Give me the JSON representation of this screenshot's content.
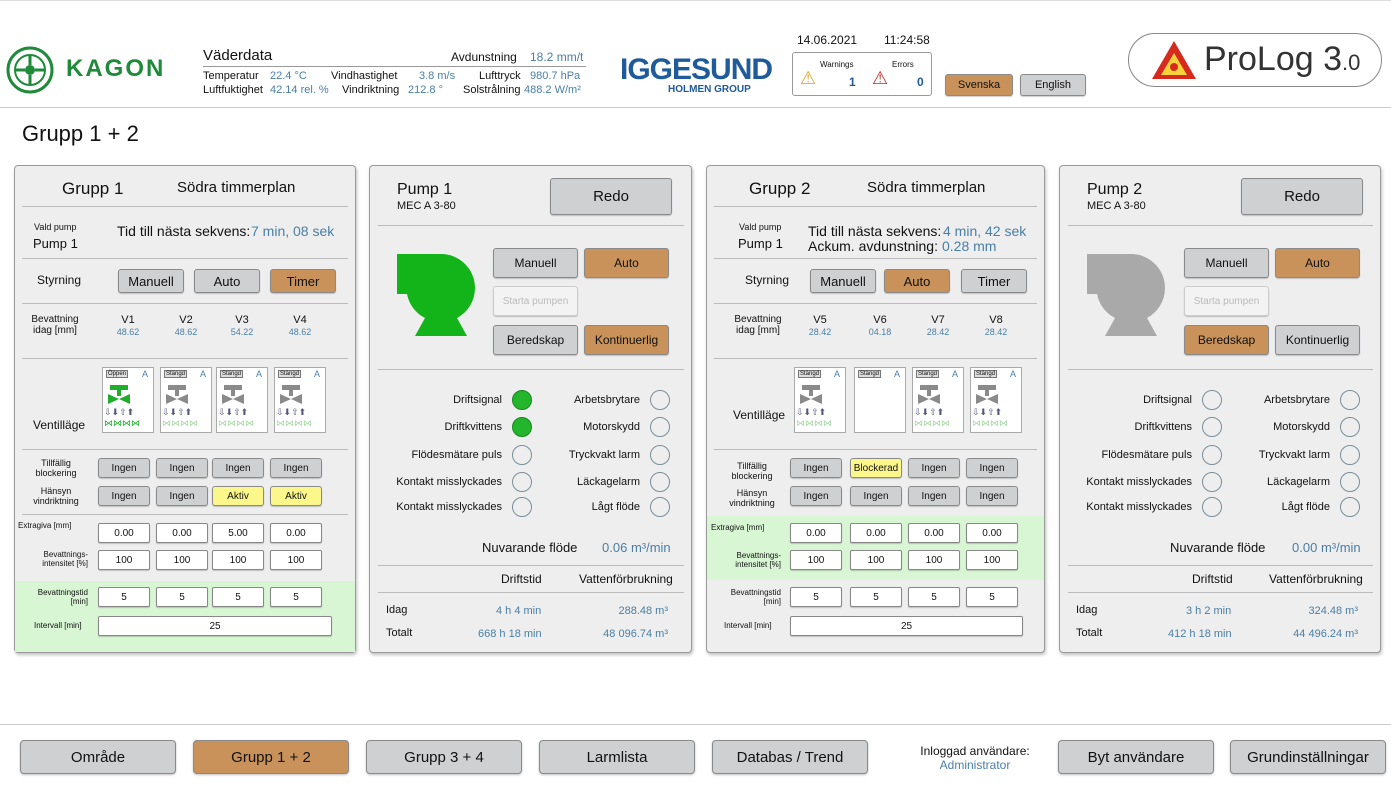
{
  "header": {
    "kagon": "KAGON",
    "kagon_small": "KAGON",
    "weather": {
      "title": "Väderdata",
      "temp_label": "Temperatur",
      "temp_value": "22.4",
      "temp_unit": "°C",
      "humid_label": "Luftfuktighet",
      "humid_value": "42.14",
      "humid_unit": "rel. %",
      "wind_label": "Vindhastighet",
      "wind_value": "3.8",
      "wind_unit": "m/s",
      "dir_label": "Vindriktning",
      "dir_value": "212.8",
      "dir_unit": "°",
      "evap_label": "Avdunstning",
      "evap_value": "18.2",
      "evap_unit": "mm/t",
      "press_label": "Lufttryck",
      "press_value": "980.7",
      "press_unit": "hPa",
      "sun_label": "Solstrålning",
      "sun_value": "488.2",
      "sun_unit": "W/m²"
    },
    "iggesund": "IGGESUND",
    "holmen": "HOLMEN GROUP",
    "date": "14.06.2021",
    "time": "11:24:58",
    "warnings_label": "Warnings",
    "warnings_count": "1",
    "errors_label": "Errors",
    "errors_count": "0",
    "lang_sv": "Svenska",
    "lang_en": "English",
    "prolog": "ProLog 3",
    "prolog_sub": ".0"
  },
  "page_title": "Grupp 1 + 2",
  "grupp1": {
    "title": "Grupp 1",
    "area": "Södra timmerplan",
    "vald_pump_label": "Vald pump",
    "vald_pump": "Pump 1",
    "tid_label": "Tid till nästa sekvens:",
    "tid_value": "7 min, 08 sek",
    "styrning": "Styrning",
    "manuell": "Manuell",
    "auto": "Auto",
    "timer": "Timer",
    "bev_label1": "Bevattning",
    "bev_label2": "idag [mm]",
    "valves": [
      {
        "name": "V1",
        "value": "48.62",
        "state": "Öppen",
        "mode": "A",
        "blocking": "Ingen",
        "wind": "Ingen",
        "extra": "0.00",
        "intens": "100",
        "tid": "5"
      },
      {
        "name": "V2",
        "value": "48.62",
        "state": "Stängd",
        "mode": "A",
        "blocking": "Ingen",
        "wind": "Ingen",
        "extra": "0.00",
        "intens": "100",
        "tid": "5"
      },
      {
        "name": "V3",
        "value": "54.22",
        "state": "Stängd",
        "mode": "A",
        "blocking": "Ingen",
        "wind": "Aktiv",
        "extra": "5.00",
        "intens": "100",
        "tid": "5"
      },
      {
        "name": "V4",
        "value": "48.62",
        "state": "Stängd",
        "mode": "A",
        "blocking": "Ingen",
        "wind": "Aktiv",
        "extra": "0.00",
        "intens": "100",
        "tid": "5"
      }
    ],
    "ventillage": "Ventilläge",
    "tillf1": "Tillfällig",
    "tillf2": "blockering",
    "hans1": "Hänsyn",
    "hans2": "vindriktning",
    "extra_label": "Extragiva [mm]",
    "intens1": "Bevattnings-",
    "intens2": "intensitet [%]",
    "tid1": "Bevattningstid",
    "tid2": "[min]",
    "intervall_label": "Intervall [min]",
    "intervall": "25"
  },
  "pump1": {
    "title": "Pump 1",
    "model": "MEC A 3-80",
    "status": "Redo",
    "manuell": "Manuell",
    "auto": "Auto",
    "starta": "Starta pumpen",
    "beredskap": "Beredskap",
    "kontinuerlig": "Kontinuerlig",
    "signals_left": [
      "Driftsignal",
      "Driftkvittens",
      "Flödesmätare puls",
      "Kontakt misslyckades",
      "Kontakt misslyckades"
    ],
    "signals_right": [
      "Arbetsbrytare",
      "Motorskydd",
      "Tryckvakt larm",
      "Läckagelarm",
      "Lågt flöde"
    ],
    "flow_label": "Nuvarande flöde",
    "flow_value": "0.06",
    "flow_unit": "m³/min",
    "col1": "Driftstid",
    "col2": "Vattenförbrukning",
    "idag": "Idag",
    "idag_tid": "4 h 4 min",
    "idag_vol": "288.48 m³",
    "totalt": "Totalt",
    "tot_tid": "668 h 18 min",
    "tot_vol": "48 096.74 m³"
  },
  "grupp2": {
    "title": "Grupp 2",
    "area": "Södra timmerplan",
    "vald_pump_label": "Vald pump",
    "vald_pump": "Pump 1",
    "tid_label": "Tid till nästa sekvens:",
    "tid_value": "4 min, 42 sek",
    "ackum_label": "Ackum. avdunstning:",
    "ackum_value": "0.28 mm",
    "styrning": "Styrning",
    "manuell": "Manuell",
    "auto": "Auto",
    "timer": "Timer",
    "bev_label1": "Bevattning",
    "bev_label2": "idag [mm]",
    "valves": [
      {
        "name": "V5",
        "value": "28.42",
        "state": "Stängd",
        "mode": "A",
        "blocking": "Ingen",
        "wind": "Ingen",
        "extra": "0.00",
        "intens": "100",
        "tid": "5"
      },
      {
        "name": "V6",
        "value": "04.18",
        "state": "Stängd",
        "mode": "A",
        "blocking": "Blockerad",
        "wind": "Ingen",
        "extra": "0.00",
        "intens": "100",
        "tid": "5"
      },
      {
        "name": "V7",
        "value": "28.42",
        "state": "Stängd",
        "mode": "A",
        "blocking": "Ingen",
        "wind": "Ingen",
        "extra": "0.00",
        "intens": "100",
        "tid": "5"
      },
      {
        "name": "V8",
        "value": "28.42",
        "state": "Stängd",
        "mode": "A",
        "blocking": "Ingen",
        "wind": "Ingen",
        "extra": "0.00",
        "intens": "100",
        "tid": "5"
      }
    ],
    "ventillage": "Ventilläge",
    "tillf1": "Tillfällig",
    "tillf2": "blockering",
    "hans1": "Hänsyn",
    "hans2": "vindriktning",
    "extra_label": "Extragiva [mm]",
    "intens1": "Bevattnings-",
    "intens2": "intensitet [%]",
    "tid1": "Bevattningstid",
    "tid2": "[min]",
    "intervall_label": "Intervall [min]",
    "intervall": "25"
  },
  "pump2": {
    "title": "Pump 2",
    "model": "MEC A 3-80",
    "status": "Redo",
    "manuell": "Manuell",
    "auto": "Auto",
    "starta": "Starta pumpen",
    "beredskap": "Beredskap",
    "kontinuerlig": "Kontinuerlig",
    "signals_left": [
      "Driftsignal",
      "Driftkvittens",
      "Flödesmätare puls",
      "Kontakt misslyckades",
      "Kontakt misslyckades"
    ],
    "signals_right": [
      "Arbetsbrytare",
      "Motorskydd",
      "Tryckvakt larm",
      "Läckagelarm",
      "Lågt flöde"
    ],
    "flow_label": "Nuvarande flöde",
    "flow_value": "0.00",
    "flow_unit": "m³/min",
    "col1": "Driftstid",
    "col2": "Vattenförbrukning",
    "idag": "Idag",
    "idag_tid": "3 h 2 min",
    "idag_vol": "324.48 m³",
    "totalt": "Totalt",
    "tot_tid": "412 h 18 min",
    "tot_vol": "44 496.24 m³"
  },
  "nav": {
    "omrade": "Område",
    "grupp12": "Grupp 1 + 2",
    "grupp34": "Grupp 3 + 4",
    "larmlista": "Larmlista",
    "databas": "Databas / Trend",
    "user_label": "Inloggad användare:",
    "user": "Administrator",
    "byt": "Byt användare",
    "grund": "Grundinställningar"
  }
}
